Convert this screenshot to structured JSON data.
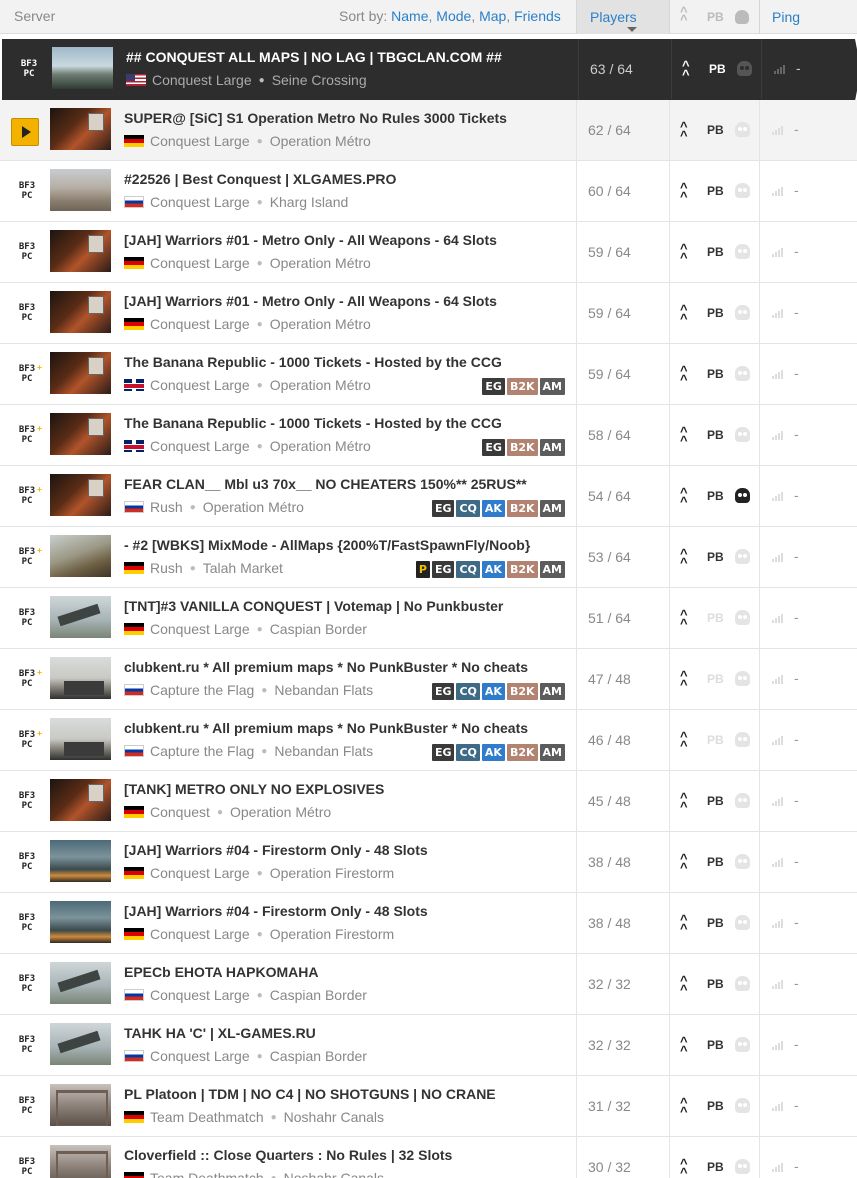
{
  "header": {
    "server_label": "Server",
    "sort_prefix": "Sort by:",
    "sort_name": "Name",
    "sort_mode": "Mode",
    "sort_map": "Map",
    "sort_friends": "Friends",
    "players_label": "Players",
    "pb_label": "PB",
    "ping_label": "Ping"
  },
  "rows": [
    {
      "name": "## CONQUEST ALL MAPS | NO LAG | TBGCLAN.COM ##",
      "flag": "us",
      "mode": "Conquest Large",
      "map": "Seine Crossing",
      "thumb": "seine",
      "players": "63 / 64",
      "pb": true,
      "skull": false,
      "ping": "-",
      "tags": [],
      "selected": true,
      "premium": false,
      "playing": false
    },
    {
      "name": "SUPER@ [SiC] S1 Operation Metro No Rules 3000 Tickets",
      "flag": "de",
      "mode": "Conquest Large",
      "map": "Operation Métro",
      "thumb": "metro",
      "players": "62 / 64",
      "pb": true,
      "skull": false,
      "ping": "-",
      "tags": [],
      "selected": false,
      "premium": false,
      "playing": true
    },
    {
      "name": "#22526 | Best Conquest | XLGAMES.PRO",
      "flag": "ru",
      "mode": "Conquest Large",
      "map": "Kharg Island",
      "thumb": "kharg",
      "players": "60 / 64",
      "pb": true,
      "skull": false,
      "ping": "-",
      "tags": [],
      "selected": false,
      "premium": false,
      "playing": false
    },
    {
      "name": "[JAH] Warriors #01 - Metro Only - All Weapons - 64 Slots",
      "flag": "de",
      "mode": "Conquest Large",
      "map": "Operation Métro",
      "thumb": "metro",
      "players": "59 / 64",
      "pb": true,
      "skull": false,
      "ping": "-",
      "tags": [],
      "selected": false,
      "premium": false,
      "playing": false
    },
    {
      "name": "[JAH] Warriors #01 - Metro Only - All Weapons - 64 Slots",
      "flag": "de",
      "mode": "Conquest Large",
      "map": "Operation Métro",
      "thumb": "metro",
      "players": "59 / 64",
      "pb": true,
      "skull": false,
      "ping": "-",
      "tags": [],
      "selected": false,
      "premium": false,
      "playing": false
    },
    {
      "name": "The Banana Republic - 1000 Tickets - Hosted by the CCG",
      "flag": "gb",
      "mode": "Conquest Large",
      "map": "Operation Métro",
      "thumb": "metro",
      "players": "59 / 64",
      "pb": true,
      "skull": false,
      "ping": "-",
      "tags": [
        "EG",
        "B2K",
        "AM"
      ],
      "selected": false,
      "premium": true,
      "playing": false
    },
    {
      "name": "The Banana Republic - 1000 Tickets - Hosted by the CCG",
      "flag": "gb",
      "mode": "Conquest Large",
      "map": "Operation Métro",
      "thumb": "metro",
      "players": "58 / 64",
      "pb": true,
      "skull": false,
      "ping": "-",
      "tags": [
        "EG",
        "B2K",
        "AM"
      ],
      "selected": false,
      "premium": true,
      "playing": false
    },
    {
      "name": "FEAR CLAN__ Mbl u3 70x__ NO CHEATERS 150%** 25RUS**",
      "flag": "ru",
      "mode": "Rush",
      "map": "Operation Métro",
      "thumb": "metro",
      "players": "54 / 64",
      "pb": true,
      "skull": true,
      "ping": "-",
      "tags": [
        "EG",
        "CQ",
        "AK",
        "B2K",
        "AM"
      ],
      "selected": false,
      "premium": true,
      "playing": false
    },
    {
      "name": "- #2 [WBKS] MixMode - AllMaps {200%T/FastSpawnFly/Noob}",
      "flag": "de",
      "mode": "Rush",
      "map": "Talah Market",
      "thumb": "talah",
      "players": "53 / 64",
      "pb": true,
      "skull": false,
      "ping": "-",
      "tags": [
        "P",
        "EG",
        "CQ",
        "AK",
        "B2K",
        "AM"
      ],
      "selected": false,
      "premium": true,
      "playing": false
    },
    {
      "name": "[TNT]#3 VANILLA CONQUEST | Votemap | No Punkbuster",
      "flag": "de",
      "mode": "Conquest Large",
      "map": "Caspian Border",
      "thumb": "caspian",
      "players": "51 / 64",
      "pb": false,
      "skull": false,
      "ping": "-",
      "tags": [],
      "selected": false,
      "premium": false,
      "playing": false
    },
    {
      "name": "clubkent.ru * All premium maps * No PunkBuster * No cheats",
      "flag": "ru",
      "mode": "Capture the Flag",
      "map": "Nebandan Flats",
      "thumb": "nebandan",
      "players": "47 / 48",
      "pb": false,
      "skull": false,
      "ping": "-",
      "tags": [
        "EG",
        "CQ",
        "AK",
        "B2K",
        "AM"
      ],
      "selected": false,
      "premium": true,
      "playing": false
    },
    {
      "name": "clubkent.ru * All premium maps * No PunkBuster * No cheats",
      "flag": "ru",
      "mode": "Capture the Flag",
      "map": "Nebandan Flats",
      "thumb": "nebandan",
      "players": "46 / 48",
      "pb": false,
      "skull": false,
      "ping": "-",
      "tags": [
        "EG",
        "CQ",
        "AK",
        "B2K",
        "AM"
      ],
      "selected": false,
      "premium": true,
      "playing": false
    },
    {
      "name": "[TANK] METRO ONLY NO EXPLOSIVES",
      "flag": "de",
      "mode": "Conquest",
      "map": "Operation Métro",
      "thumb": "metro",
      "players": "45 / 48",
      "pb": true,
      "skull": false,
      "ping": "-",
      "tags": [],
      "selected": false,
      "premium": false,
      "playing": false
    },
    {
      "name": "[JAH] Warriors #04 - Firestorm Only - 48 Slots",
      "flag": "de",
      "mode": "Conquest Large",
      "map": "Operation Firestorm",
      "thumb": "firestorm",
      "players": "38 / 48",
      "pb": true,
      "skull": false,
      "ping": "-",
      "tags": [],
      "selected": false,
      "premium": false,
      "playing": false
    },
    {
      "name": "[JAH] Warriors #04 - Firestorm Only - 48 Slots",
      "flag": "de",
      "mode": "Conquest Large",
      "map": "Operation Firestorm",
      "thumb": "firestorm",
      "players": "38 / 48",
      "pb": true,
      "skull": false,
      "ping": "-",
      "tags": [],
      "selected": false,
      "premium": false,
      "playing": false
    },
    {
      "name": "EPECb EHOTA HAPKOMAHA",
      "flag": "ru",
      "mode": "Conquest Large",
      "map": "Caspian Border",
      "thumb": "caspian",
      "players": "32 / 32",
      "pb": true,
      "skull": false,
      "ping": "-",
      "tags": [],
      "selected": false,
      "premium": false,
      "playing": false
    },
    {
      "name": "TAHK HA 'C' | XL-GAMES.RU",
      "flag": "ru",
      "mode": "Conquest Large",
      "map": "Caspian Border",
      "thumb": "caspian",
      "players": "32 / 32",
      "pb": true,
      "skull": false,
      "ping": "-",
      "tags": [],
      "selected": false,
      "premium": false,
      "playing": false
    },
    {
      "name": "PL Platoon | TDM | NO C4 | NO SHOTGUNS | NO CRANE",
      "flag": "de",
      "mode": "Team Deathmatch",
      "map": "Noshahr Canals",
      "thumb": "noshahr",
      "players": "31 / 32",
      "pb": true,
      "skull": false,
      "ping": "-",
      "tags": [],
      "selected": false,
      "premium": false,
      "playing": false
    },
    {
      "name": "Cloverfield :: Close Quarters : No Rules | 32 Slots",
      "flag": "de",
      "mode": "Team Deathmatch",
      "map": "Noshahr Canals",
      "thumb": "noshahr",
      "players": "30 / 32",
      "pb": true,
      "skull": false,
      "ping": "-",
      "tags": [],
      "selected": false,
      "premium": false,
      "playing": false
    }
  ],
  "badge": {
    "line1": "BF3",
    "line2": "PC"
  },
  "colors": {
    "accent": "#2a7fc9",
    "selected_bg": "#2d2d2d",
    "play": "#f3b200"
  }
}
